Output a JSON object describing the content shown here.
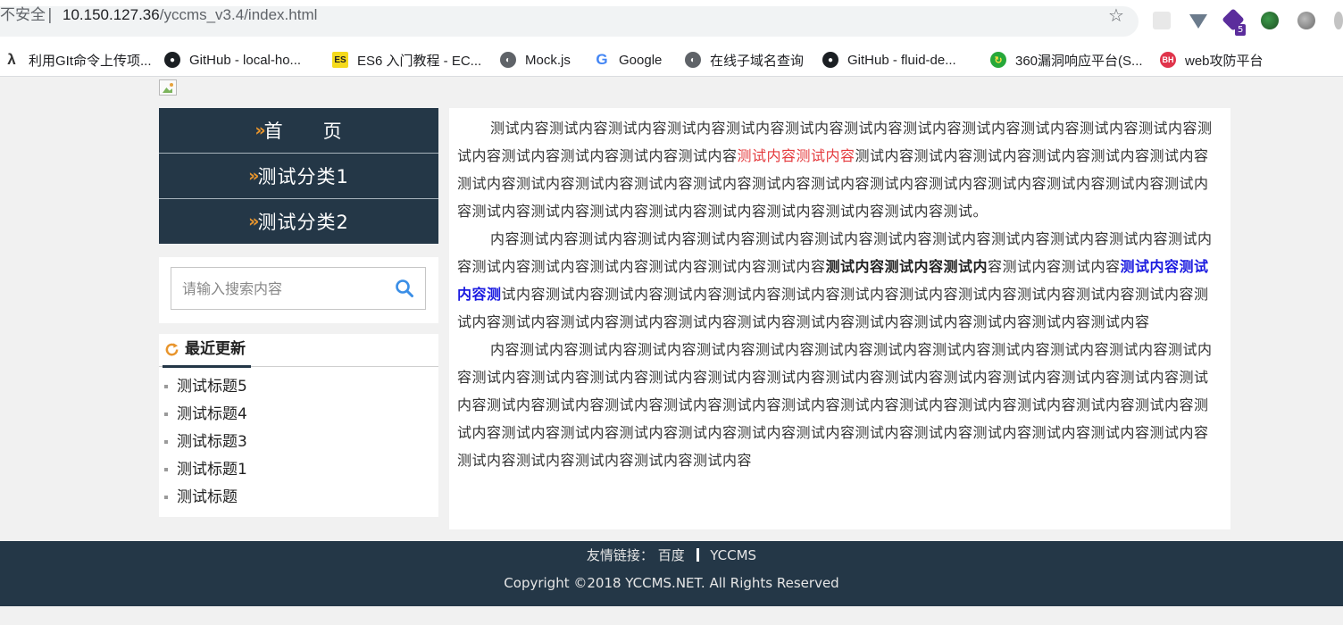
{
  "browser": {
    "insecure_label": "不安全",
    "separator": "|",
    "url_host": "10.150.127.36",
    "url_path": "/yccms_v3.4/index.html",
    "bookmarks": [
      {
        "label": "利用GIt命令上传项...",
        "icon": "lambda-icon"
      },
      {
        "label": "GitHub - local-ho...",
        "icon": "github-icon"
      },
      {
        "label": "ES6 入门教程 - EC...",
        "icon": "es-icon"
      },
      {
        "label": "Mock.js",
        "icon": "globe-icon"
      },
      {
        "label": "Google",
        "icon": "google-icon"
      },
      {
        "label": "在线子域名查询",
        "icon": "globe-icon"
      },
      {
        "label": "GitHub - fluid-de...",
        "icon": "github-icon"
      },
      {
        "label": "360漏洞响应平台(S...",
        "icon": "360-icon"
      },
      {
        "label": "web攻防平台",
        "icon": "bh-icon"
      }
    ],
    "extension_badge": "5"
  },
  "nav": {
    "items": [
      {
        "label": "首　　页"
      },
      {
        "label": "测试分类1"
      },
      {
        "label": "测试分类2"
      }
    ]
  },
  "search": {
    "placeholder": "请输入搜索内容"
  },
  "recent": {
    "title": "最近更新",
    "items": [
      "测试标题5",
      "测试标题4",
      "测试标题3",
      "测试标题1",
      "测试标题"
    ]
  },
  "content": {
    "p1_a": "测试内容测试内容测试内容测试内容测试内容测试内容测试内容测试内容测试内容测试内容测试内容测试内容测试内容测试内容测试内容测试内容测试内容",
    "p1_red": "测试内容测试内容",
    "p1_b": "测试内容测试内容测试内容测试内容测试内容测试内容测试内容测试内容测试内容测试内容测试内容测试内容测试内容测试内容测试内容测试内容测试内容测试内容测试内容测试内容测试内容测试内容测试内容测试内容测试内容测试内容测试内容测试。",
    "p2_a": "内容测试内容测试内容测试内容测试内容测试内容测试内容测试内容测试内容测试内容测试内容测试内容测试内容测试内容测试内容测试内容测试内容测试内容测试内容",
    "p2_bold": "测试内容测试内容测试内",
    "p2_b": "容测试内容测试内容",
    "p2_blue": "测试内容测试内容测",
    "p2_c": "试内容测试内容测试内容测试内容测试内容测试内容测试内容测试内容测试内容测试内容测试内容测试内容测试内容测试内容测试内容测试内容测试内容测试内容测试内容测试内容测试内容测试内容测试内容测试内容",
    "p3": "内容测试内容测试内容测试内容测试内容测试内容测试内容测试内容测试内容测试内容测试内容测试内容测试内容测试内容测试内容测试内容测试内容测试内容测试内容测试内容测试内容测试内容测试内容测试内容测试内容测试内容测试内容测试内容测试内容测试内容测试内容测试内容测试内容测试内容测试内容测试内容测试内容测试内容测试内容测试内容测试内容测试内容测试内容测试内容测试内容测试内容测试内容测试内容测试内容测试内容测试内容测试内容测试内容测试内容测试内容测试内容"
  },
  "footer": {
    "links_label": "友情链接：",
    "links": [
      "百度",
      "YCCMS"
    ],
    "copyright": "Copyright ©2018 YCCMS.NET. All Rights Reserved"
  },
  "colors": {
    "nav_bg": "#243747",
    "arrow": "#e8952d",
    "search_icon": "#3a8ee6",
    "red_text": "#e4393c",
    "blue_text": "#1a1ae0"
  }
}
